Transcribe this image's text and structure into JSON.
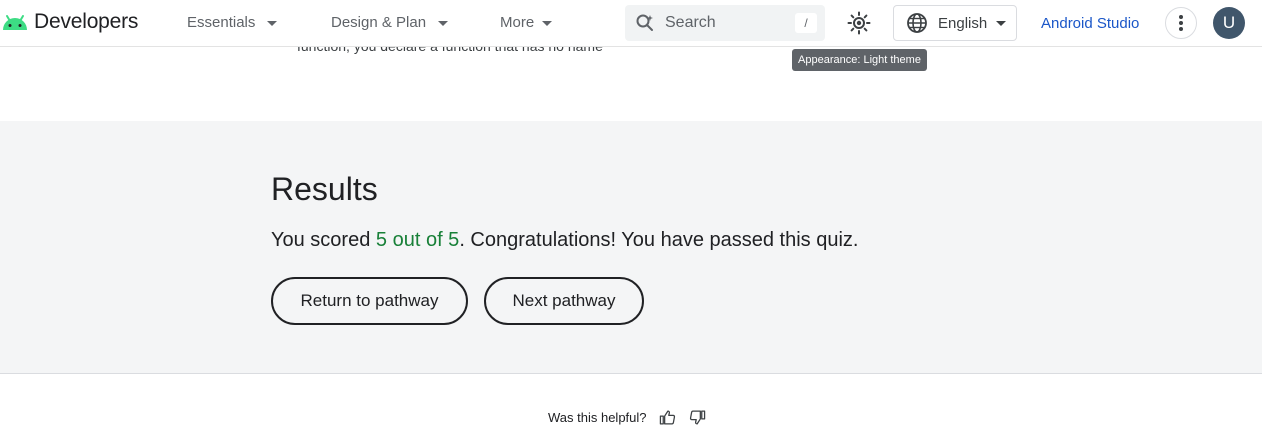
{
  "header": {
    "logo_text": "Developers",
    "nav": [
      {
        "label": "Essentials"
      },
      {
        "label": "Design & Plan"
      },
      {
        "label": "More"
      }
    ],
    "search": {
      "placeholder": "Search",
      "shortcut": "/"
    },
    "theme_icon": "sun-icon",
    "language": {
      "label": "English",
      "icon": "globe-icon"
    },
    "studio_link": "Android Studio",
    "more_icon": "vertical-dots-icon",
    "avatar_initial": "U"
  },
  "tooltip": "Appearance: Light theme",
  "prev_content_text": "function, you declare a function that has no name",
  "results": {
    "title": "Results",
    "score_prefix": "You scored ",
    "score_highlight": "5 out of 5",
    "score_suffix": ". Congratulations! You have passed this quiz.",
    "buttons": {
      "return_label": "Return to pathway",
      "next_label": "Next pathway"
    }
  },
  "feedback": {
    "label": "Was this helpful?",
    "up_icon": "thumb-up-icon",
    "down_icon": "thumb-down-icon"
  },
  "colors": {
    "brand_green": "#3ddc84",
    "link_blue": "#1a56c8",
    "score_green": "#188038",
    "section_bg": "#f4f5f6"
  }
}
